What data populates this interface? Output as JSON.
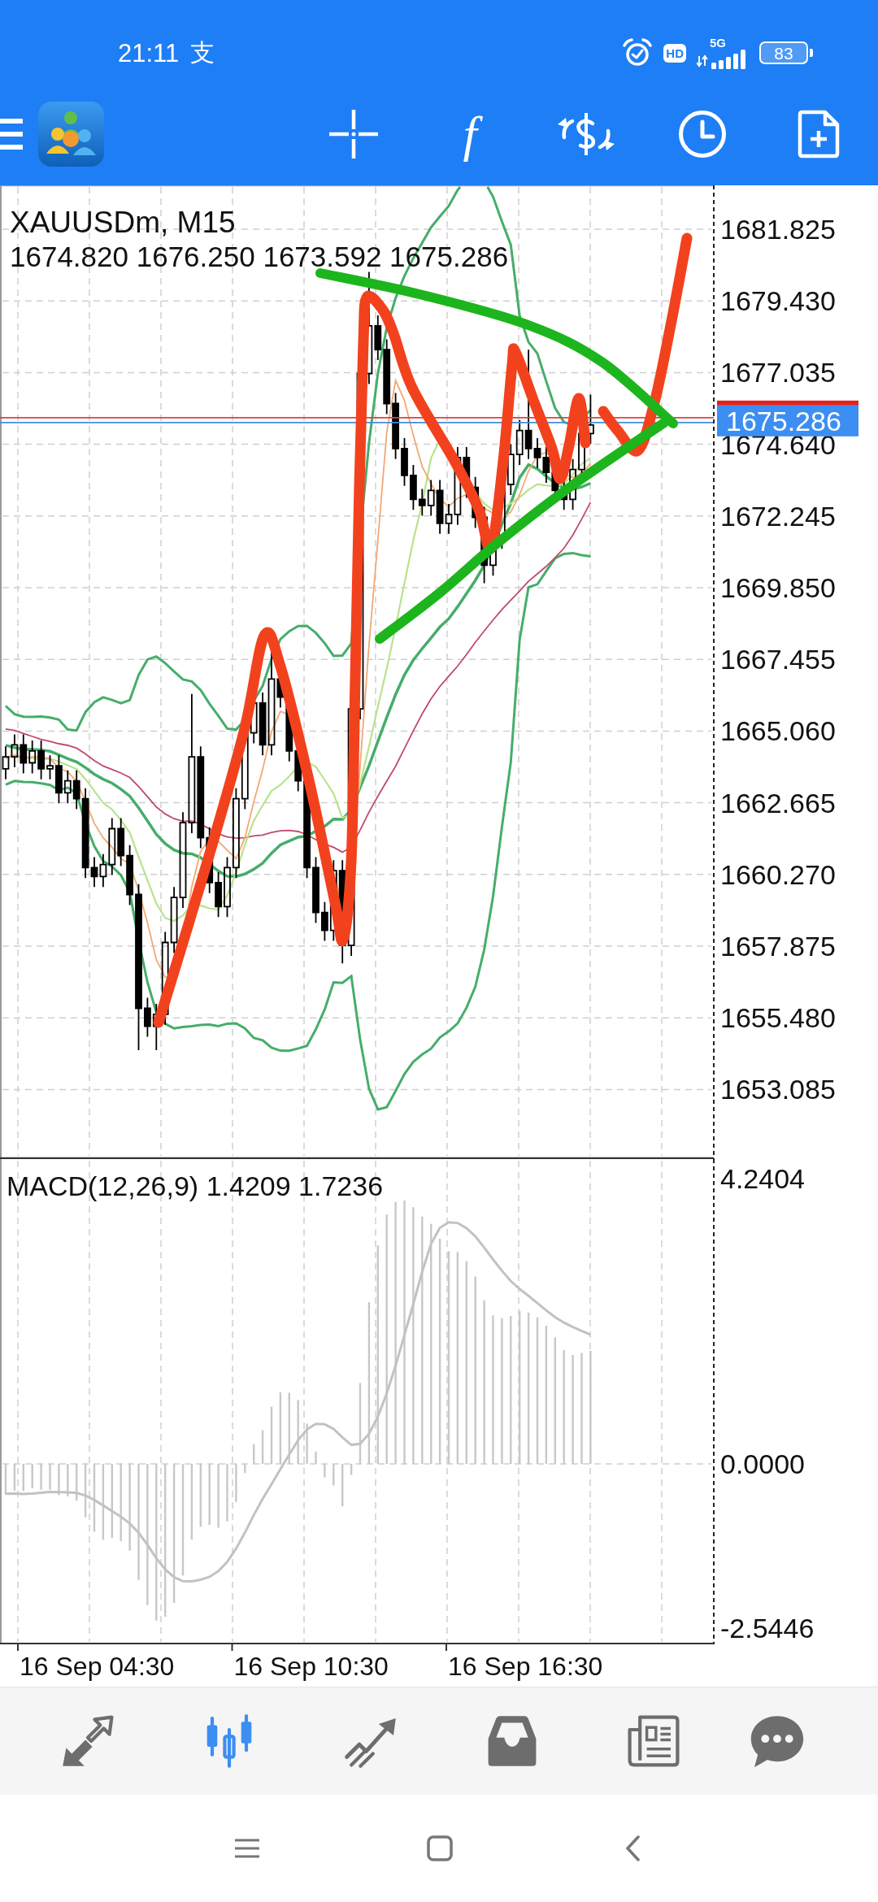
{
  "status_bar": {
    "time": "21:11",
    "notification": "支",
    "hd": "HD",
    "network": "5G",
    "battery": "83"
  },
  "toolbar": {
    "indicators_glyph": "f"
  },
  "chart": {
    "symbol": "XAUUSDm, M15",
    "ohlc": "1674.820 1676.250 1673.592 1675.286",
    "price_axis": [
      "1681.825",
      "1679.430",
      "1677.035",
      "1674.640",
      "1672.245",
      "1669.850",
      "1667.455",
      "1665.060",
      "1662.665",
      "1660.270",
      "1657.875",
      "1655.480",
      "1653.085"
    ],
    "current_price": "1675.286"
  },
  "macd": {
    "title": "MACD(12,26,9) 1.4209 1.7236",
    "axis": [
      "4.2404",
      "0.0000",
      "-2.5446"
    ]
  },
  "time_axis": [
    "16 Sep 04:30",
    "16 Sep 10:30",
    "16 Sep 16:30"
  ],
  "bottom_nav": [
    {
      "kind": "arrows",
      "selected": false
    },
    {
      "kind": "candles",
      "selected": true
    },
    {
      "kind": "trend",
      "selected": false
    },
    {
      "kind": "inbox",
      "selected": false
    },
    {
      "kind": "newspaper",
      "selected": false
    },
    {
      "kind": "chat",
      "selected": false
    }
  ]
}
